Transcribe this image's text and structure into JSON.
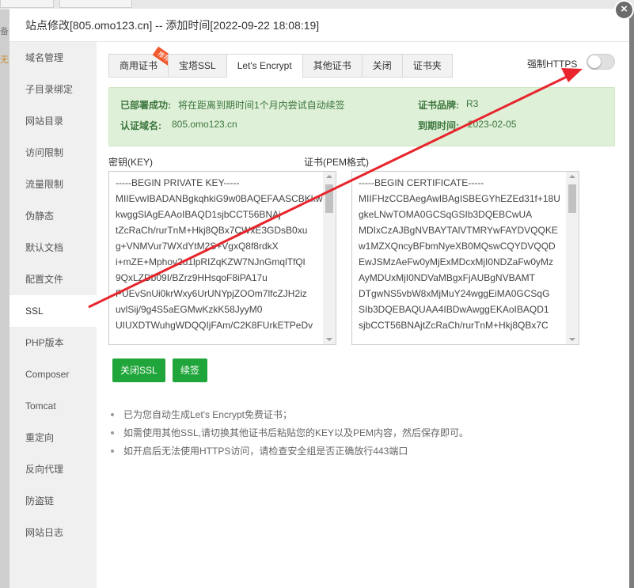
{
  "background": {
    "top_left_char": "备",
    "left_char": "无"
  },
  "dialog": {
    "title": "站点修改[805.omo123.cn] -- 添加时间[2022-09-22 18:08:19]",
    "close_symbol": "×"
  },
  "sidebar": {
    "items": [
      {
        "label": "域名管理"
      },
      {
        "label": "子目录绑定"
      },
      {
        "label": "网站目录"
      },
      {
        "label": "访问限制"
      },
      {
        "label": "流量限制"
      },
      {
        "label": "伪静态"
      },
      {
        "label": "默认文档"
      },
      {
        "label": "配置文件"
      },
      {
        "label": "SSL"
      },
      {
        "label": "PHP版本"
      },
      {
        "label": "Composer"
      },
      {
        "label": "Tomcat"
      },
      {
        "label": "重定向"
      },
      {
        "label": "反向代理"
      },
      {
        "label": "防盗链"
      },
      {
        "label": "网站日志"
      }
    ],
    "active": "SSL"
  },
  "tabs": [
    {
      "label": "商用证书",
      "badge": "推荐"
    },
    {
      "label": "宝塔SSL"
    },
    {
      "label": "Let's Encrypt"
    },
    {
      "label": "其他证书"
    },
    {
      "label": "关闭"
    },
    {
      "label": "证书夹"
    }
  ],
  "active_tab": "Let's Encrypt",
  "force_https": {
    "label": "强制HTTPS",
    "enabled": false
  },
  "status": {
    "deployed_label": "已部署成功:",
    "deployed_value": "将在距离到期时间1个月内尝试自动续签",
    "brand_label": "证书品牌:",
    "brand_value": "R3",
    "domain_label": "认证域名:",
    "domain_value": "805.omo123.cn",
    "expire_label": "到期时间:",
    "expire_value": "2023-02-05"
  },
  "key_field": {
    "label": "密钥(KEY)",
    "lines": [
      "-----BEGIN PRIVATE KEY-----",
      "MIIEvwIBADANBgkqhkiG9w0BAQEFAASCBKkwgg",
      "kwggSlAgEAAoIBAQD1sjbCCT56BNAj",
      "tZcRaCh/rurTnM+Hkj8QBx7CWxE3GDsB0xu",
      "g+VNMVur7WXdYtM2S+VgxQ8f8rdkX",
      "i+mZE+Mphov2u1lpRIZqKZW7NJnGmqlTfQl",
      "9QxLZDb09I/BZrz9HHsqoF8iPA17u",
      "PUEvSnUi0krWxy6UrUNYpjZOOm7lfcZJH2iz",
      "uvlSij/9g4S5aEGMwKzkK58JyyM0",
      "UIUXDTWuhgWDQQIjFAm/C2K8FUrkETPeDv"
    ]
  },
  "cert_field": {
    "label": "证书(PEM格式)",
    "lines": [
      "-----BEGIN CERTIFICATE-----",
      "MIIFHzCCBAegAwIBAgISBEGYhEZEd31f+18U",
      "gkeLNwTOMA0GCSqGSIb3DQEBCwUA",
      "MDIxCzAJBgNVBAYTAlVTMRYwFAYDVQQKE",
      "w1MZXQncyBFbmNyeXB0MQswCQYDVQQD",
      "EwJSMzAeFw0yMjExMDcxMjI0NDZaFw0yMz",
      "AyMDUxMjI0NDVaMBgxFjAUBgNVBAMT",
      "DTgwNS5vbW8xMjMuY24wggEiMA0GCSqG",
      "SIb3DQEBAQUAA4IBDwAwggEKAoIBAQD1",
      "sjbCCT56BNAjtZcRaCh/rurTnM+Hkj8QBx7C"
    ]
  },
  "buttons": {
    "close_ssl": "关闭SSL",
    "renew": "续签"
  },
  "notes": [
    "已为您自动生成Let's Encrypt免费证书；",
    "如需使用其他SSL,请切换其他证书后粘贴您的KEY以及PEM内容，然后保存即可。",
    "如开启后无法使用HTTPS访问，请检查安全组是否正确放行443端口"
  ],
  "colors": {
    "accent_green": "#20a53a",
    "success_bg": "#dff0d8",
    "success_text": "#3c763d",
    "annotation_arrow": "#e8252c",
    "badge": "#f0582d"
  }
}
